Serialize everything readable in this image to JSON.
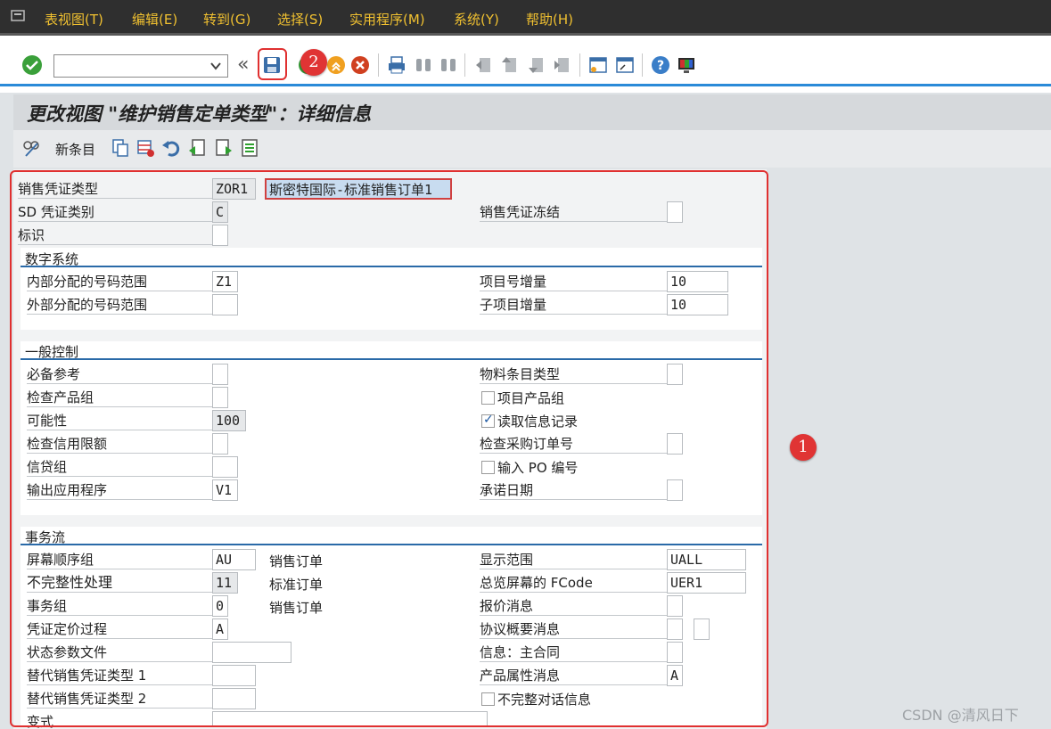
{
  "menu": [
    "表视图(T)",
    "编辑(E)",
    "转到(G)",
    "选择(S)",
    "实用程序(M)",
    "系统(Y)",
    "帮助(H)"
  ],
  "page_title": "更改视图 \"维护销售定单类型\"：详细信息",
  "app_toolbar": {
    "new_entries": "新条目"
  },
  "header_fields": {
    "doc_type_label": "销售凭证类型",
    "doc_type_value": "ZOR1",
    "doc_type_desc": "斯密特国际-标准销售订单1",
    "sd_cat_label": "SD 凭证类别",
    "sd_cat_value": "C",
    "block_label": "销售凭证冻结",
    "indicator_label": "标识"
  },
  "number_system": {
    "title": "数字系统",
    "internal_label": "内部分配的号码范围",
    "internal_value": "Z1",
    "external_label": "外部分配的号码范围",
    "item_incr_label": "项目号增量",
    "item_incr_value": "10",
    "subitem_incr_label": "子项目增量",
    "subitem_incr_value": "10"
  },
  "general_control": {
    "title": "一般控制",
    "ref_mandatory_label": "必备参考",
    "check_division_label": "检查产品组",
    "probability_label": "可能性",
    "probability_value": "100",
    "check_credit_label": "检查信用限额",
    "credit_group_label": "信贷组",
    "output_app_label": "输出应用程序",
    "output_app_value": "V1",
    "material_entry_label": "物料条目类型",
    "item_division_label": "项目产品组",
    "read_info_label": "读取信息记录",
    "check_po_label": "检查采购订单号",
    "enter_po_label": "输入 PO 编号",
    "commit_date_label": "承诺日期"
  },
  "transaction_flow": {
    "title": "事务流",
    "screen_seq_label": "屏幕顺序组",
    "screen_seq_value": "AU",
    "screen_seq_desc": "销售订单",
    "incompletion_label": "不完整性处理",
    "incompletion_value": "11",
    "incompletion_desc": "标准订单",
    "trans_group_label": "事务组",
    "trans_group_value": "0",
    "trans_group_desc": "销售订单",
    "doc_pricing_label": "凭证定价过程",
    "doc_pricing_value": "A",
    "status_profile_label": "状态参数文件",
    "alt_type1_label": "替代销售凭证类型 1",
    "alt_type2_label": "替代销售凭证类型 2",
    "variant_label": "变式",
    "display_range_label": "显示范围",
    "display_range_value": "UALL",
    "fcode_label": "总览屏幕的 FCode",
    "fcode_value": "UER1",
    "quotation_msg_label": "报价消息",
    "outline_msg_label": "协议概要消息",
    "master_contract_label": "信息：主合同",
    "product_attr_label": "产品属性消息",
    "product_attr_value": "A",
    "incomplete_dialog_label": "不完整对话信息"
  },
  "annotations": {
    "badge1": "1",
    "badge2": "2"
  },
  "watermark": "CSDN @清风日下",
  "icons": [
    "sap-logo-icon",
    "enter-check-icon",
    "save-icon",
    "back-icon",
    "exit-icon",
    "cancel-icon",
    "print-icon",
    "find-icon",
    "find-next-icon",
    "first-page-icon",
    "prev-page-icon",
    "next-page-icon",
    "last-page-icon",
    "new-session-icon",
    "shortcut-icon",
    "help-icon",
    "layout-icon",
    "display-change-icon",
    "copy-as-icon",
    "delete-icon",
    "undo-icon",
    "prev-entry-icon",
    "next-entry-icon",
    "select-all-icon"
  ],
  "colors": {
    "menu_text": "#f0c030",
    "accent_blue": "#2a8ad8",
    "annotation_red": "#e03030"
  }
}
